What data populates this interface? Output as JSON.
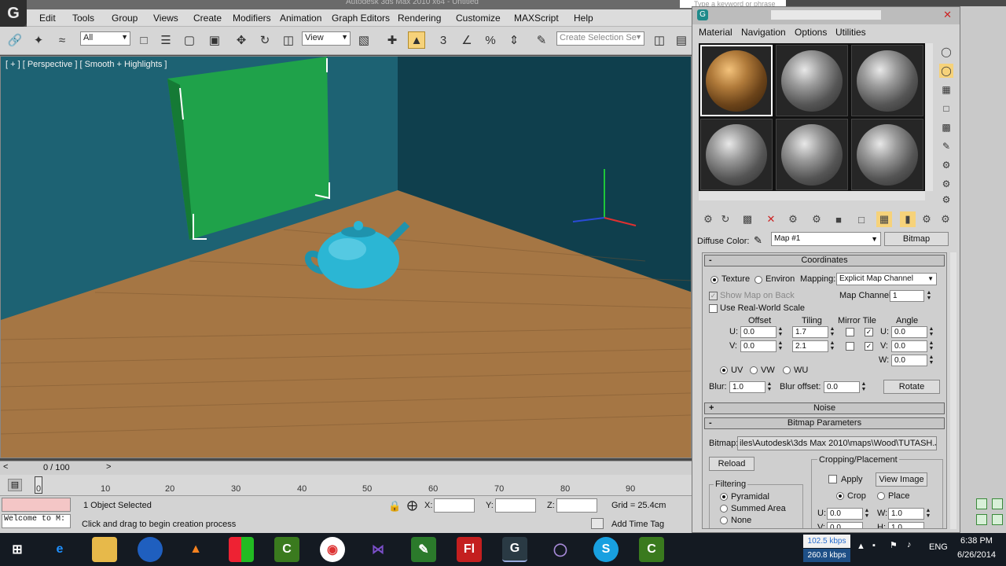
{
  "app": {
    "window_title": "Autodesk 3ds Max 2010 x64 - Untitled",
    "logo": "G"
  },
  "search": {
    "placeholder": "Type a keyword or phrase"
  },
  "menu": [
    "Edit",
    "Tools",
    "Group",
    "Views",
    "Create",
    "Modifiers",
    "Animation",
    "Graph Editors",
    "Rendering",
    "Customize",
    "MAXScript",
    "Help"
  ],
  "toolbar": {
    "filter_value": "All",
    "refcoord_value": "View",
    "selection_set_placeholder": "Create Selection Se",
    "snap_label": "3"
  },
  "viewport": {
    "label": "[ + ] [ Perspective ] [ Smooth + Highlights ]"
  },
  "timeline": {
    "frame_label": "0 / 100",
    "ticks": [
      "0",
      "10",
      "20",
      "30",
      "40",
      "50",
      "60",
      "70",
      "80",
      "90"
    ]
  },
  "status": {
    "selection": "1 Object Selected",
    "prompt": "Click and drag to begin creation process",
    "maxscript": "Welcome to M:",
    "x_label": "X:",
    "y_label": "Y:",
    "z_label": "Z:",
    "grid": "Grid = 25.4cm",
    "add_time_tag": "Add Time Tag"
  },
  "material_editor": {
    "menus": [
      "Material",
      "Navigation",
      "Options",
      "Utilities"
    ],
    "diffuse_label": "Diffuse Color:",
    "map_name": "Map #1",
    "map_type": "Bitmap",
    "coordinates": {
      "title": "Coordinates",
      "texture": "Texture",
      "environ": "Environ",
      "mapping_label": "Mapping:",
      "mapping_value": "Explicit Map Channel",
      "show_map_on_back": "Show Map on Back",
      "map_channel_label": "Map Channel:",
      "map_channel_value": "1",
      "real_world": "Use Real-World Scale",
      "offset": "Offset",
      "tiling": "Tiling",
      "mirror_tile": "Mirror Tile",
      "angle": "Angle",
      "u_label": "U:",
      "v_label": "V:",
      "w_label": "W:",
      "offset_u": "0.0",
      "offset_v": "0.0",
      "tiling_u": "1.7",
      "tiling_v": "2.1",
      "angle_u": "0.0",
      "angle_v": "0.0",
      "angle_w": "0.0",
      "uv": "UV",
      "vw": "VW",
      "wu": "WU",
      "blur_label": "Blur:",
      "blur_value": "1.0",
      "blur_offset_label": "Blur offset:",
      "blur_offset_value": "0.0",
      "rotate": "Rotate"
    },
    "noise": {
      "title": "Noise"
    },
    "bitmap_params": {
      "title": "Bitmap Parameters",
      "bitmap_label": "Bitmap:",
      "bitmap_path": "iles\\Autodesk\\3ds Max 2010\\maps\\Wood\\TUTASH.JPG",
      "reload": "Reload",
      "cropping": "Cropping/Placement",
      "apply": "Apply",
      "view_image": "View Image",
      "crop": "Crop",
      "place": "Place",
      "u_label": "U:",
      "w_label": "W:",
      "v_label": "V:",
      "h_label": "H:",
      "u_value": "0.0",
      "w_value": "1.0",
      "v_value": "0.0",
      "h_value": "1.0",
      "filtering": "Filtering",
      "filters": [
        "Pyramidal",
        "Summed Area",
        "None"
      ]
    }
  },
  "taskbar": {
    "net_up": "102.5 kbps",
    "net_down": "260.8 kbps",
    "lang": "ENG",
    "time": "6:38 PM",
    "date": "6/26/2014"
  },
  "colors": {
    "accent": "#f6d27a",
    "wall": "#1b5a6b",
    "floor": "#a87a45",
    "teapot": "#2bb6d4"
  }
}
